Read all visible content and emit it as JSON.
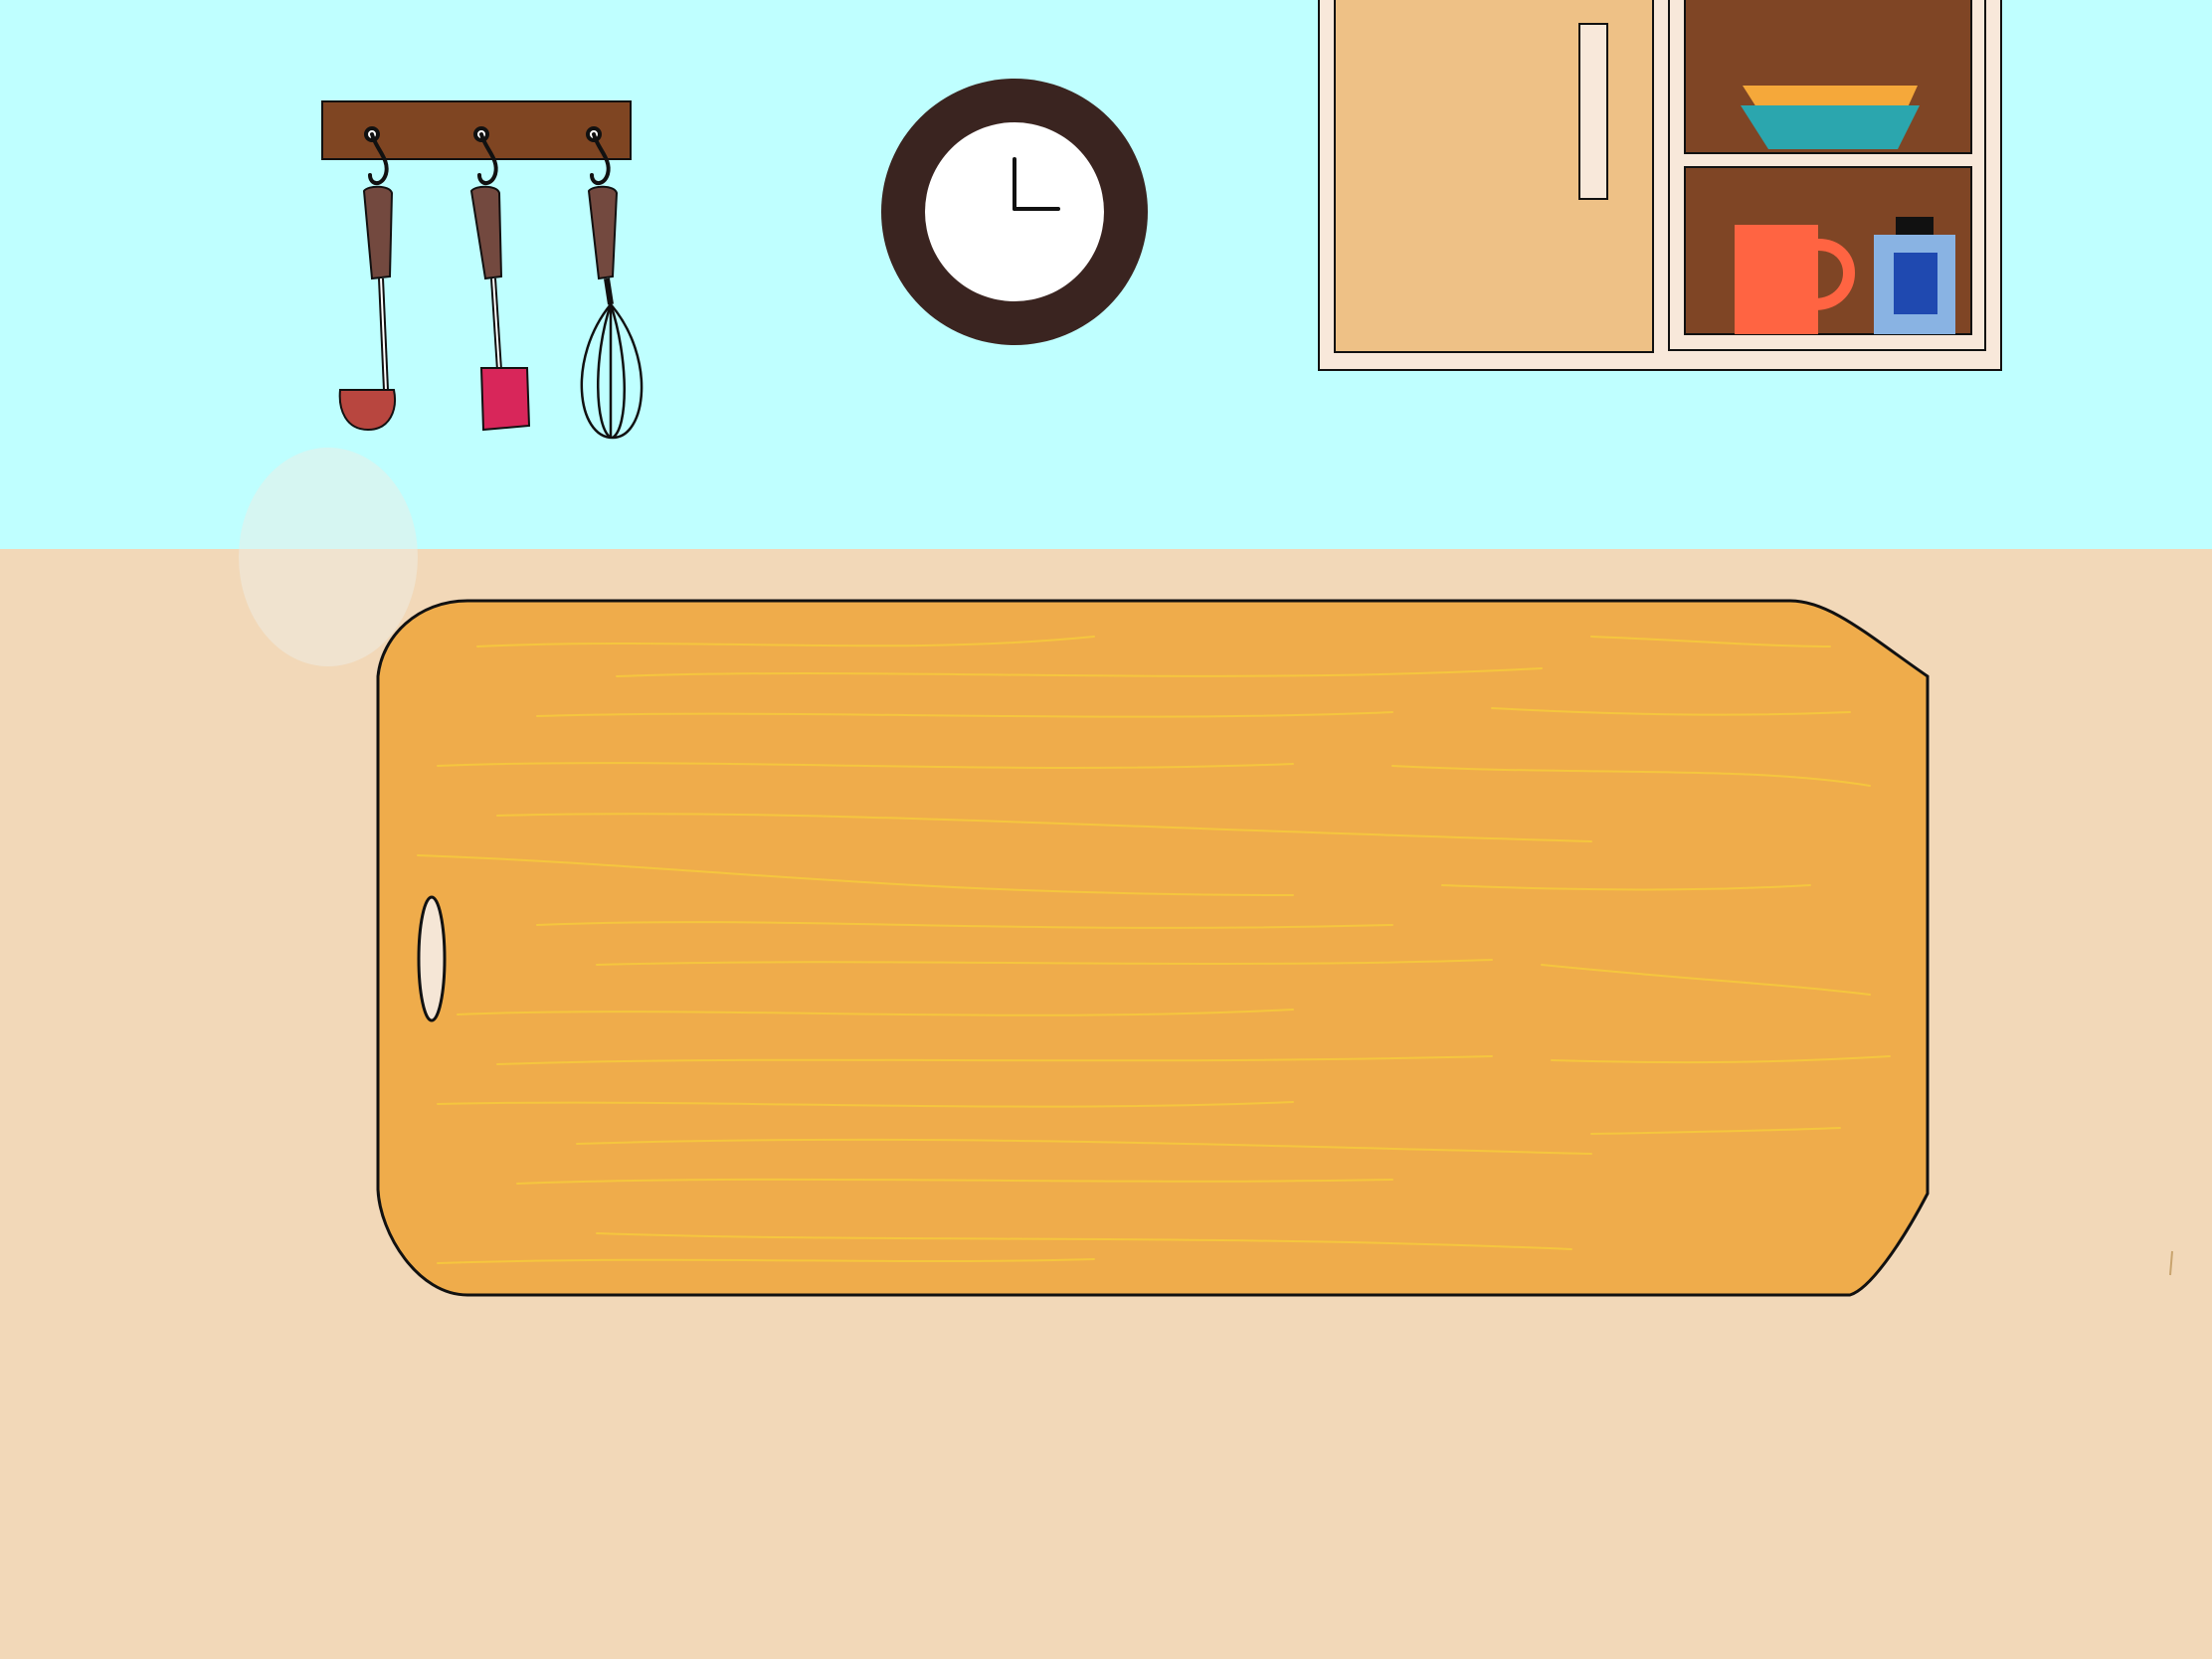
{
  "scene": {
    "description_hidden": "",
    "colors": {
      "wall": "#BFFFFF",
      "counter": "#F2D8B8",
      "rack": "#7F4522",
      "ladle": "#B8463F",
      "spatula": "#D8265A",
      "utensil_handle": "#73493F",
      "clock_rim": "#3A2420",
      "clock_face": "#FFFFFF",
      "cabinet_door": "#EEC186",
      "cabinet_frame": "#F8E8DA",
      "shelf_back": "#7F4525",
      "bowl_top": "#F5A83A",
      "bowl_bottom": "#2BA6AE",
      "mug": "#FF6442",
      "bottle": "#89B3E3",
      "bottle_label": "#1F49B0",
      "board": "#EFAC4B",
      "board_grain": "#F6C93D"
    },
    "clock": {
      "hours": 3,
      "minutes": 0
    },
    "icons": [
      "utensil-rack-icon",
      "ladle-icon",
      "spatula-icon",
      "whisk-icon",
      "wall-clock-icon",
      "cabinet-icon",
      "bowls-icon",
      "mug-icon",
      "bottle-icon",
      "cutting-board-icon"
    ]
  }
}
